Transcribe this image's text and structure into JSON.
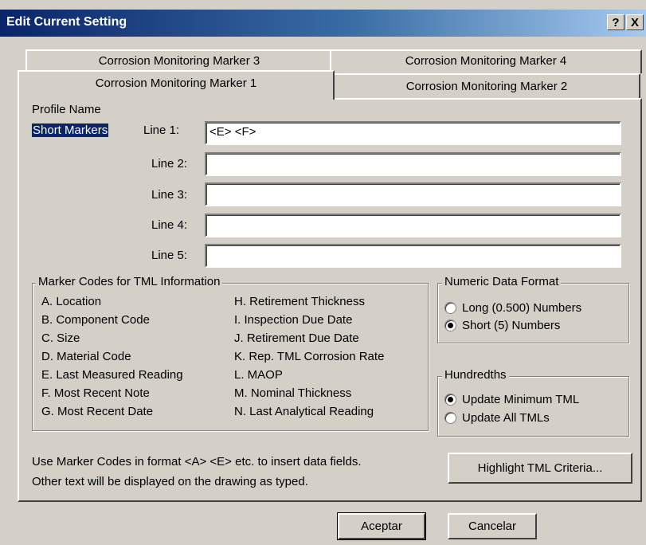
{
  "window": {
    "title": "Edit Current Setting",
    "help_label": "?",
    "close_label": "X"
  },
  "tabs": [
    {
      "label": "Corrosion Monitoring Marker 3"
    },
    {
      "label": "Corrosion Monitoring Marker 4"
    },
    {
      "label": "Corrosion Monitoring Marker 1",
      "active": true
    },
    {
      "label": "Corrosion Monitoring Marker 2"
    }
  ],
  "profile": {
    "label": "Profile Name",
    "value": "Short Markers"
  },
  "lines": [
    {
      "label": "Line 1:",
      "value": "<E> <F>"
    },
    {
      "label": "Line 2:",
      "value": ""
    },
    {
      "label": "Line 3:",
      "value": ""
    },
    {
      "label": "Line 4:",
      "value": ""
    },
    {
      "label": "Line 5:",
      "value": ""
    }
  ],
  "marker_codes": {
    "title": "Marker Codes for TML Information",
    "left": [
      "A. Location",
      "B. Component Code",
      "C. Size",
      "D. Material Code",
      "E. Last Measured Reading",
      "F. Most Recent Note",
      "G. Most Recent Date"
    ],
    "right": [
      "H. Retirement Thickness",
      "I. Inspection Due Date",
      "J. Retirement Due Date",
      "K. Rep. TML Corrosion Rate",
      "L. MAOP",
      "M. Nominal Thickness",
      "N. Last Analytical Reading"
    ]
  },
  "numeric_format": {
    "title": "Numeric Data Format",
    "options": [
      {
        "label": "Long (0.500) Numbers",
        "selected": false
      },
      {
        "label": "Short (5) Numbers",
        "selected": true
      }
    ]
  },
  "hundredths": {
    "title": "Hundredths",
    "options": [
      {
        "label": "Update Minimum TML",
        "selected": true
      },
      {
        "label": "Update All TMLs",
        "selected": false
      }
    ]
  },
  "help_text": {
    "line1": "Use Marker Codes in format <A> <E> etc. to insert data fields.",
    "line2": "Other text will be displayed on the drawing as typed."
  },
  "buttons": {
    "highlight": "Highlight TML Criteria...",
    "ok": "Aceptar",
    "cancel": "Cancelar"
  }
}
